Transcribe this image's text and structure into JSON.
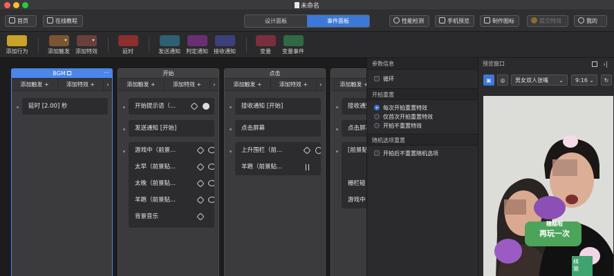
{
  "window": {
    "title": "未命名"
  },
  "topbar": {
    "home": "首页",
    "tutorial": "在线教程",
    "tabs": [
      "设计面板",
      "事件面板"
    ],
    "active_tab": 1,
    "perf": "性能检测",
    "phone_preview": "手机预览",
    "make_icon": "制作图标",
    "submit": "提交特效",
    "me": "我的"
  },
  "actions": [
    {
      "label": "添加行为",
      "color": "#c9a227",
      "dropdown": false
    },
    {
      "label": "添加触发",
      "color": "#7a5532",
      "dropdown": true
    },
    {
      "label": "添加特效",
      "color": "#6a3f3a",
      "dropdown": true
    },
    {
      "label": "延时",
      "color": "#8a2e2e",
      "dropdown": false
    },
    {
      "label": "发送通知",
      "color": "#2f5f73",
      "dropdown": false
    },
    {
      "label": "判定通知",
      "color": "#6a2f73",
      "dropdown": false
    },
    {
      "label": "接收通知",
      "color": "#3d3f7a",
      "dropdown": false
    },
    {
      "label": "变量",
      "color": "#7a2f3e",
      "dropdown": false
    },
    {
      "label": "变量事件",
      "color": "#2f6a45",
      "dropdown": false
    }
  ],
  "columns": [
    {
      "title": "BGM",
      "add_trigger": "添加触发 +",
      "add_effect": "添加特效 +",
      "cards": [
        {
          "text": "延时 [2.00] 秒",
          "icons": []
        }
      ]
    },
    {
      "title": "开始",
      "add_trigger": "添加触发 +",
      "add_effect": "添加特效 +",
      "cards": [
        {
          "text": "开始提示语（...",
          "icons": [
            "diamond",
            "fill"
          ]
        },
        {
          "text": "发送通知 [开始]",
          "icons": []
        },
        {
          "text": "游戏中（前景...",
          "icons": [
            "diamond",
            "link"
          ]
        },
        {
          "text": "太早（前景贴...",
          "icons": [
            "diamond",
            "link"
          ]
        },
        {
          "text": "太晚（前景贴...",
          "icons": [
            "diamond",
            "link"
          ]
        },
        {
          "text": "羊跑（前景贴...",
          "icons": [
            "diamond",
            "link"
          ]
        },
        {
          "text": "背景音乐",
          "icons": [
            "diamond"
          ]
        }
      ]
    },
    {
      "title": "点击",
      "add_trigger": "添加触发 +",
      "add_effect": "添加特效 +",
      "cards": [
        {
          "text": "接收通知 [开始]",
          "icons": []
        },
        {
          "text": "点击屏幕",
          "icons": []
        },
        {
          "text": "上升围栏（前...",
          "icons": [
            "diamond",
            "circle"
          ]
        },
        {
          "text": "羊跑（前景贴...",
          "icons": [
            "pause"
          ]
        }
      ]
    },
    {
      "title": "",
      "add_trigger": "添加触发 +",
      "add_effect": "",
      "cards": [
        {
          "text": "接收通知",
          "icons": []
        },
        {
          "text": "点击屏幕",
          "icons": []
        },
        {
          "text": "[前景贴",
          "icons": []
        },
        {
          "text": "栅栏碰",
          "icons": []
        },
        {
          "text": "游戏中",
          "icons": []
        }
      ]
    }
  ],
  "props": {
    "param_header": "参数信息",
    "loop": "循环",
    "replay_header": "开拍重置",
    "replay_options": [
      "每次开拍重置特效",
      "仅首次开拍重置特效",
      "开拍不重置特效"
    ],
    "replay_selected": 0,
    "random_header": "随机选项重置",
    "random_option": "开拍后不重置随机选项"
  },
  "preview": {
    "header": "预览窗口",
    "model": "男女双人张嘴",
    "ratio": "9:16",
    "sticker_lines": [
      "糟糕啦",
      "再玩一次"
    ],
    "side_text": "棋 猿"
  }
}
